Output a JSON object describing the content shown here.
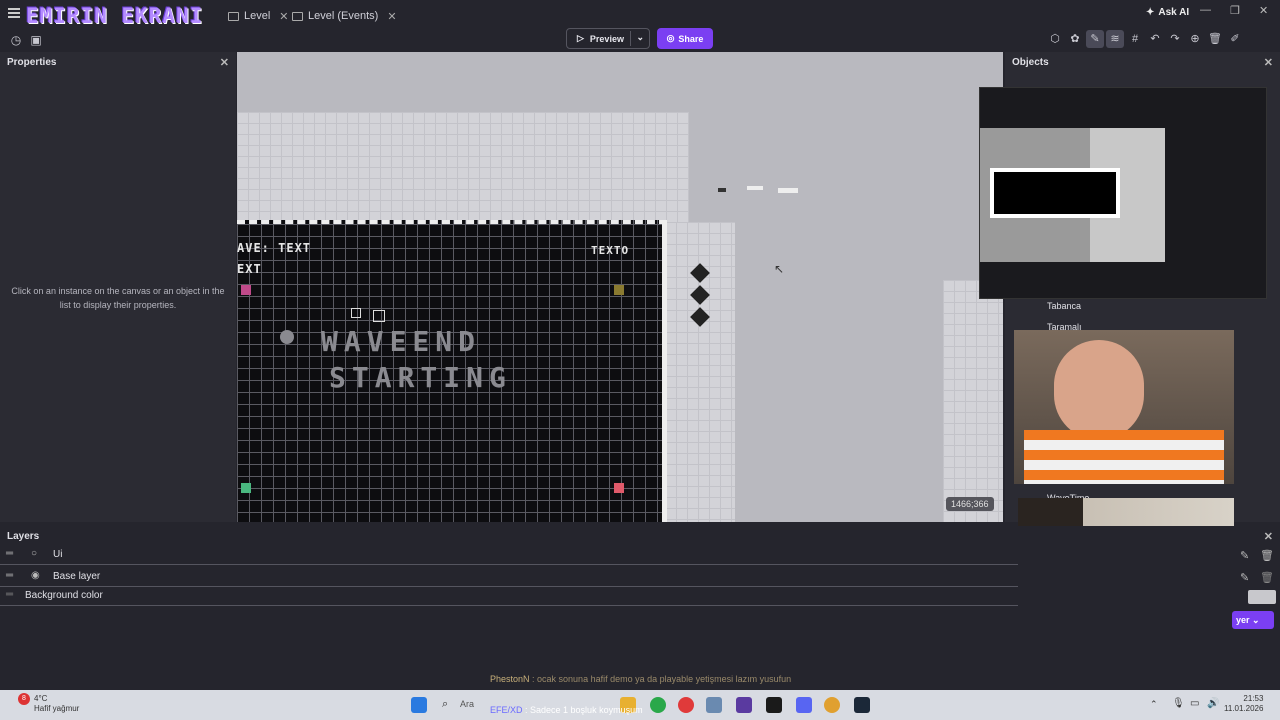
{
  "overlay": {
    "streamer_title": "EMIRIN EKRANI"
  },
  "tabs": [
    {
      "label": "Level"
    },
    {
      "label": "Level (Events)"
    }
  ],
  "header": {
    "ask_ai": "Ask AI"
  },
  "toolbar": {
    "preview_label": "Preview",
    "share_label": "Share"
  },
  "properties": {
    "title": "Properties",
    "empty_message": "Click on an instance on the canvas or an object in the list to display their properties."
  },
  "canvas": {
    "wave_text": "AVE: TEXT",
    "ext_text": "EXT",
    "texto": "TEXTO",
    "big_line1": "WAVEEND",
    "big_line2": "STARTING",
    "coordinates": "1466;366"
  },
  "objects": {
    "title": "Objects",
    "items": [
      "Tabanca",
      "Taramalı",
      "WaveTime"
    ]
  },
  "layers": {
    "title": "Layers",
    "rows": [
      {
        "label": "Ui"
      },
      {
        "label": "Base layer"
      },
      {
        "label": "Background color"
      }
    ],
    "add_layer": "yer"
  },
  "chat": {
    "user": "PhestonN",
    "message": " : ocak sonuna hafif demo ya da playable yetişmesi lazım yusufun",
    "user2": "EFE/XD",
    "message2": " : Sadece 1 boşluk koymuşum"
  },
  "taskbar": {
    "weather_temp": "4°C",
    "weather_desc": "Hafif yağmur",
    "search": "Ara",
    "time": "21:53",
    "date": "11.01.2026",
    "notif_count": "8"
  },
  "colors": {
    "accent": "#7b3ff2",
    "marker_pink": "#c04a8a",
    "marker_olive": "#8a7a30",
    "marker_green": "#4ab880",
    "marker_red": "#e05a6a"
  }
}
